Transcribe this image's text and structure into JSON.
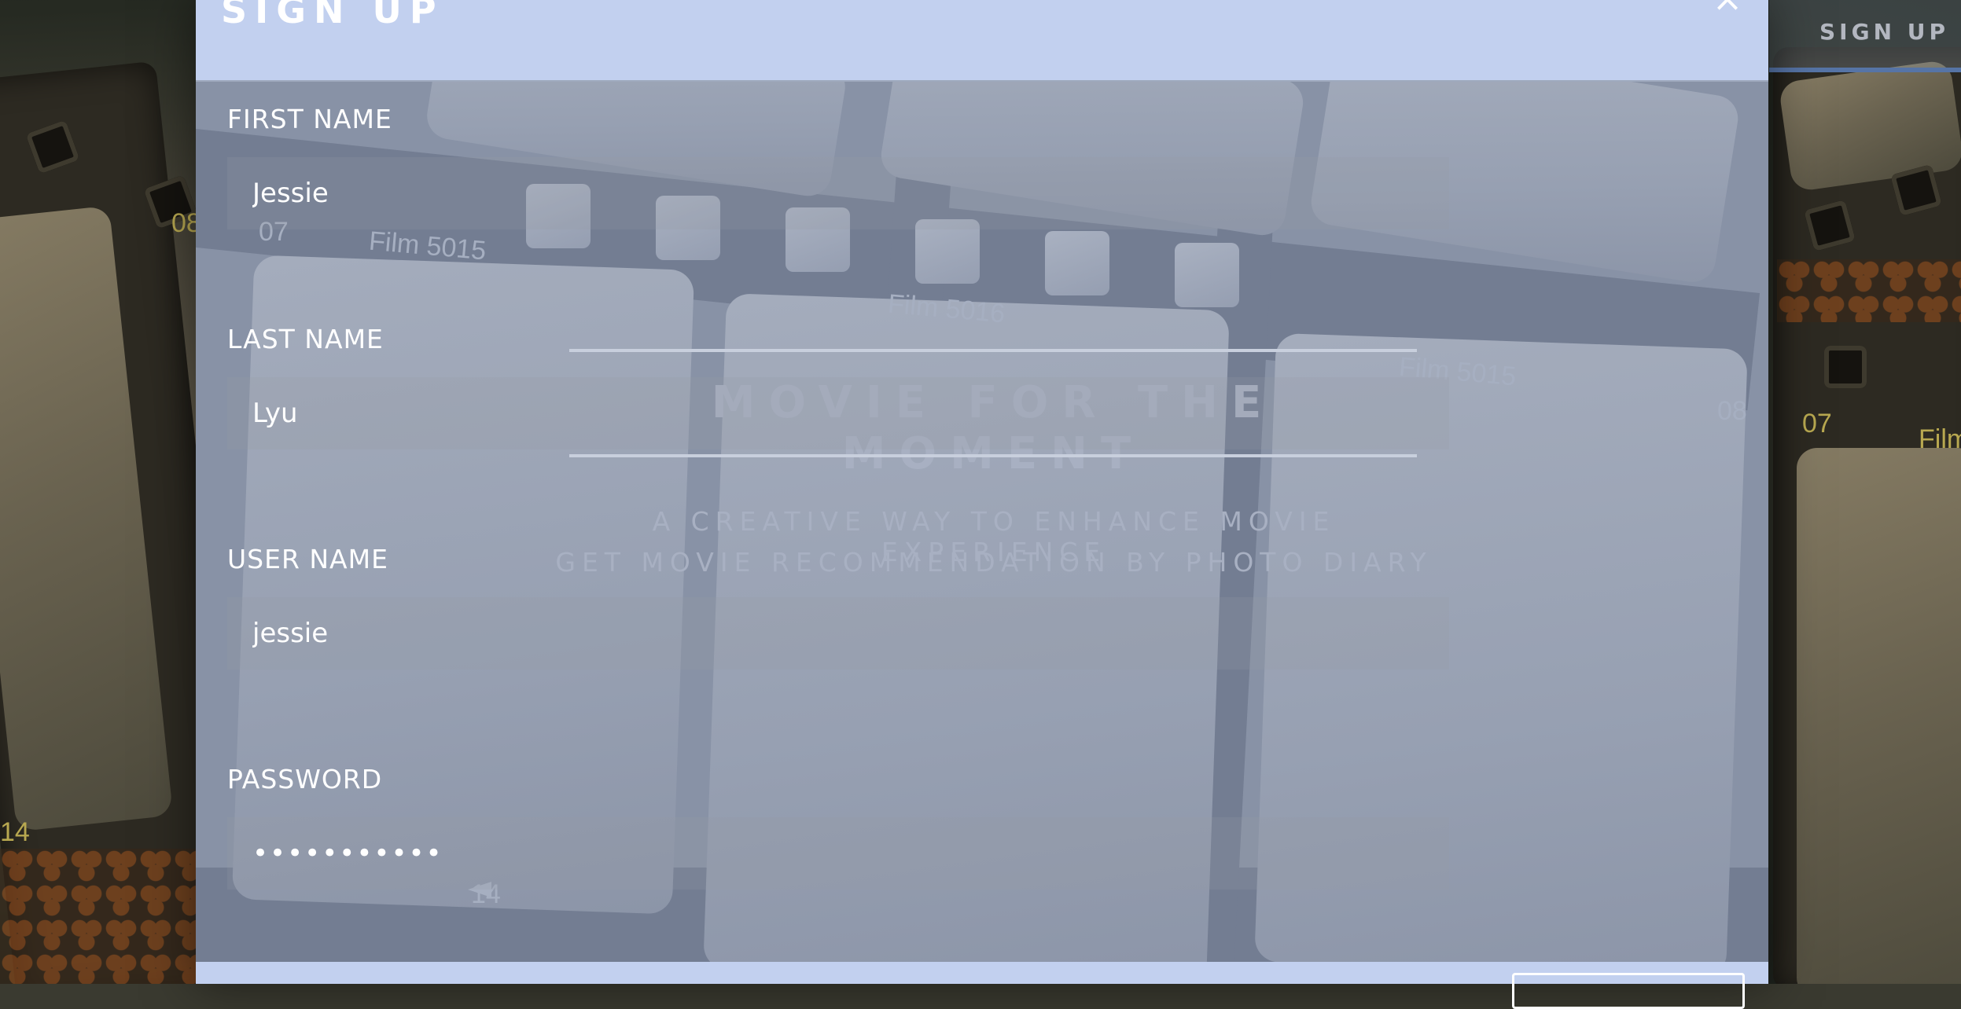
{
  "page": {
    "top_nav": {
      "signup_label": "SIGN UP"
    }
  },
  "modal": {
    "title": "SIGN UP",
    "close_icon": "close-icon",
    "fields": [
      {
        "label": "FIRST NAME",
        "value": "Jessie",
        "type": "text"
      },
      {
        "label": "LAST NAME",
        "value": "Lyu",
        "type": "text"
      },
      {
        "label": "USER NAME",
        "value": "jessie",
        "type": "text"
      },
      {
        "label": "PASSWORD",
        "value": "•••••••••••",
        "type": "password"
      }
    ],
    "background_overlay": {
      "title": "MOVIE FOR THE MOMENT",
      "subtitle_line1": "A CREATIVE WAY TO ENHANCE MOVIE EXPERIENCE",
      "subtitle_line2": "GET MOVIE RECOMMENDATION BY PHOTO DIARY"
    },
    "film_labels": [
      "Film 5015",
      "Film 5016",
      "Film 5015",
      "07",
      "08",
      "14"
    ]
  },
  "colors": {
    "modal_bg": "#c2d0ef",
    "modal_body": "#8892a6",
    "accent_bar": "#5674a6"
  }
}
